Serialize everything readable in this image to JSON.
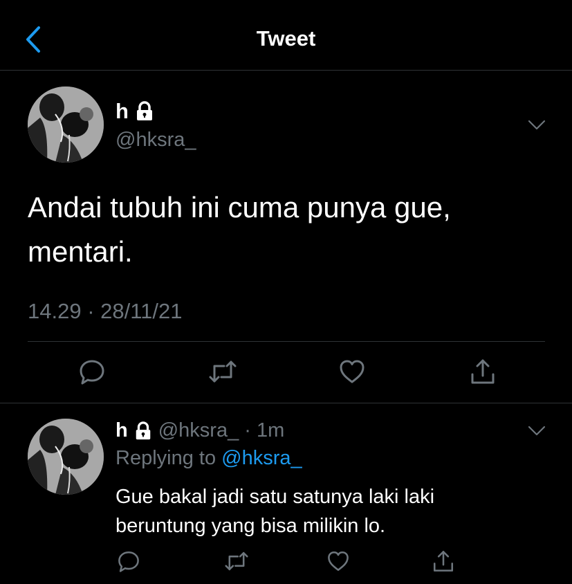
{
  "header": {
    "title": "Tweet",
    "back_icon": "chevron-left-icon"
  },
  "main_tweet": {
    "display_name": "h",
    "handle": "@hksra_",
    "text_line1": "Andai tubuh ini cuma punya gue,",
    "text_line2": "mentari.",
    "timestamp": "14.29 · 28/11/21",
    "lock_icon": "lock-icon",
    "actions": [
      "reply-icon",
      "retweet-icon",
      "like-icon",
      "share-icon"
    ]
  },
  "reply_tweet": {
    "display_name": "h",
    "meta": "@hksra_ · 1m",
    "replying_prefix": "Replying to ",
    "replying_handle": "@hksra_",
    "text_line1": "Gue bakal jadi satu satunya laki laki",
    "text_line2": "beruntung yang bisa milikin lo.",
    "actions": [
      "reply-icon",
      "retweet-icon",
      "like-icon",
      "share-icon"
    ]
  },
  "colors": {
    "background": "#000000",
    "text": "#ffffff",
    "secondary": "#6e767d",
    "accent": "#1d9bf0",
    "divider": "#2f3336"
  }
}
